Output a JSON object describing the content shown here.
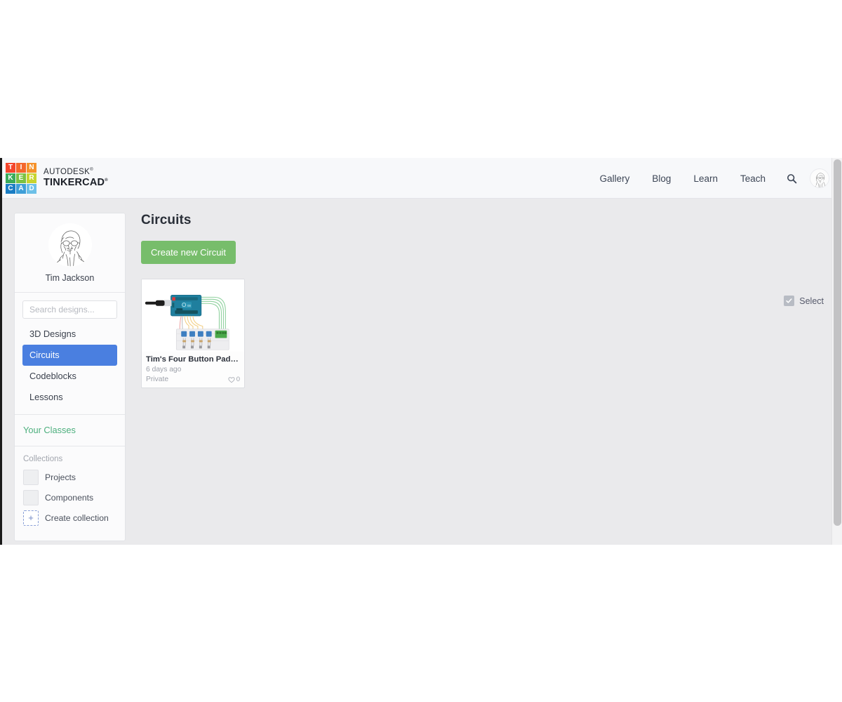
{
  "header": {
    "logo_tiles": [
      {
        "letter": "T",
        "color": "#f4462c"
      },
      {
        "letter": "I",
        "color": "#f4672c"
      },
      {
        "letter": "N",
        "color": "#f5922c"
      },
      {
        "letter": "K",
        "color": "#3aab5a"
      },
      {
        "letter": "E",
        "color": "#7cc242"
      },
      {
        "letter": "R",
        "color": "#c8d42e"
      },
      {
        "letter": "C",
        "color": "#1a7dc4"
      },
      {
        "letter": "A",
        "color": "#3f9fd8"
      },
      {
        "letter": "D",
        "color": "#6dc0e8"
      }
    ],
    "brand_line1": "AUTODESK",
    "brand_line2": "TINKERCAD",
    "nav": [
      {
        "label": "Gallery",
        "name": "nav-gallery"
      },
      {
        "label": "Blog",
        "name": "nav-blog"
      },
      {
        "label": "Learn",
        "name": "nav-learn"
      },
      {
        "label": "Teach",
        "name": "nav-teach"
      }
    ],
    "search_icon": "search-icon",
    "avatar_icon": "user-avatar"
  },
  "sidebar": {
    "user_name": "Tim Jackson",
    "search_placeholder": "Search designs...",
    "items": [
      {
        "label": "3D Designs",
        "active": false,
        "name": "sidebar-item-3d-designs"
      },
      {
        "label": "Circuits",
        "active": true,
        "name": "sidebar-item-circuits"
      },
      {
        "label": "Codeblocks",
        "active": false,
        "name": "sidebar-item-codeblocks"
      },
      {
        "label": "Lessons",
        "active": false,
        "name": "sidebar-item-lessons"
      }
    ],
    "classes_label": "Your Classes",
    "collections_header": "Collections",
    "collections": [
      {
        "label": "Projects",
        "name": "collection-projects"
      },
      {
        "label": "Components",
        "name": "collection-components"
      }
    ],
    "create_collection_label": "Create collection",
    "create_collection_icon": "plus-icon"
  },
  "main": {
    "title": "Circuits",
    "create_button": "Create new Circuit",
    "select_label": "Select",
    "select_checked": true,
    "designs": [
      {
        "title": "Tim's Four Button Pad Check",
        "date": "6 days ago",
        "privacy": "Private",
        "likes": "0",
        "thumbnail": "arduino-four-button-circuit"
      }
    ]
  },
  "colors": {
    "accent_blue": "#4a7fe0",
    "accent_green": "#77bd6b",
    "classes_green": "#4caf7d",
    "page_bg": "#eaeaec",
    "header_bg": "#f7f8fa"
  }
}
